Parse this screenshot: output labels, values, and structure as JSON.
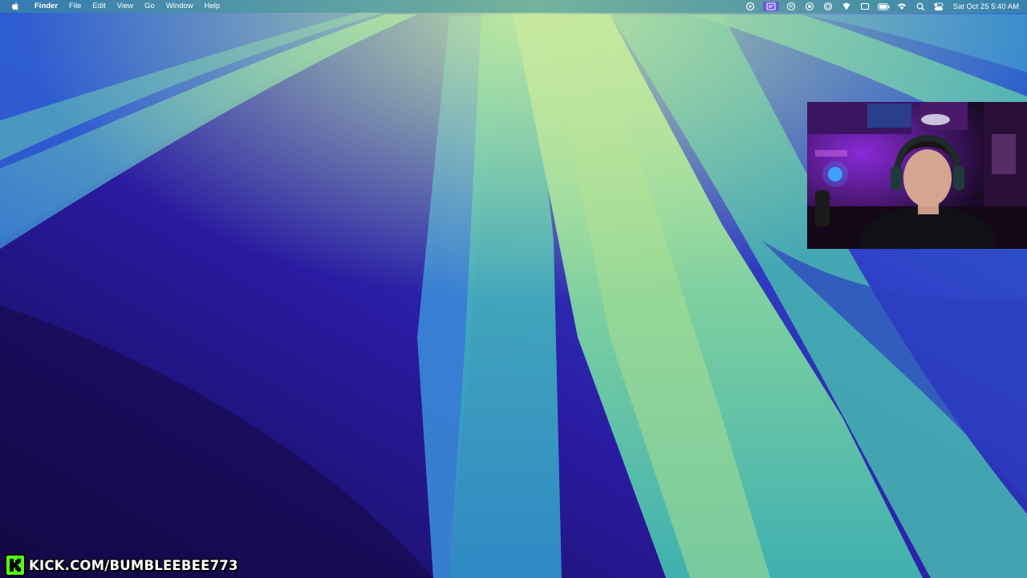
{
  "menubar": {
    "apple_icon": "apple-logo-icon",
    "app_name": "Finder",
    "menus": [
      "File",
      "Edit",
      "View",
      "Go",
      "Window",
      "Help"
    ],
    "status_icons": [
      "screen-share-icon",
      "stage-manager-icon",
      "music-recognition-icon",
      "screen-record-icon",
      "focus-icon",
      "shield-icon",
      "window-icon",
      "battery-icon",
      "wifi-icon",
      "spotlight-search-icon",
      "control-center-icon"
    ],
    "active_status_icon": "stage-manager-icon",
    "clock": "Sat Oct 25  5:40 AM"
  },
  "watermark": {
    "logo_letter": "K",
    "text": "KICK.COM/BUMBLEEBEE773",
    "logo_color": "#53fc18"
  },
  "colors": {
    "wallpaper_deep": "#1a0f6b",
    "wallpaper_blue": "#2a4fd0",
    "wallpaper_teal": "#3fb3a8",
    "wallpaper_mint": "#a6dc8f",
    "active_highlight": "#6f58d8"
  }
}
